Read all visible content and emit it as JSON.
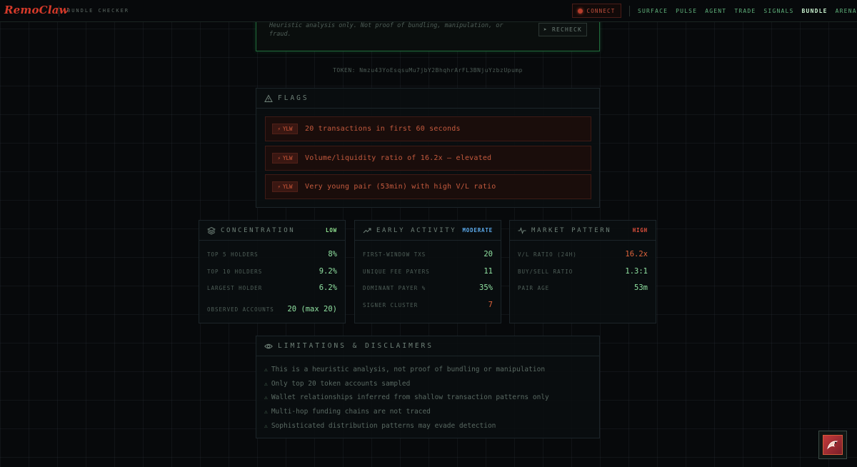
{
  "header": {
    "logo": "RemoClaw",
    "subtitle": "BUNDLE CHECKER",
    "connect_label": "CONNECT",
    "nav": [
      "SURFACE",
      "PULSE",
      "AGENT",
      "TRADE",
      "SIGNALS",
      "BUNDLE",
      "ARENA"
    ],
    "active_nav": "BUNDLE"
  },
  "summary": {
    "heuristic_note": "Heuristic analysis only. Not proof of bundling, manipulation, or fraud.",
    "recheck_label": "➤ RECHECK",
    "token_label": "TOKEN: Nmzu43YoEsqsuMu7jbY2BhqhrArFL3BNjuYzbzUpump"
  },
  "flags": {
    "title": "FLAGS",
    "items": [
      {
        "badge": "YLW",
        "text": "20 transactions in first 60 seconds"
      },
      {
        "badge": "YLW",
        "text": "Volume/liquidity ratio of 16.2x — elevated"
      },
      {
        "badge": "YLW",
        "text": "Very young pair (53min) with high V/L ratio"
      }
    ]
  },
  "cards": {
    "concentration": {
      "title": "CONCENTRATION",
      "level": "LOW",
      "level_color": "#8fe08f",
      "rows": [
        {
          "k": "TOP 5 HOLDERS",
          "v": "8%"
        },
        {
          "k": "TOP 10 HOLDERS",
          "v": "9.2%"
        },
        {
          "k": "LARGEST HOLDER",
          "v": "6.2%"
        },
        {
          "k": "OBSERVED ACCOUNTS",
          "v": "20 (max 20)"
        }
      ]
    },
    "early": {
      "title": "EARLY ACTIVITY",
      "level": "MODERATE",
      "level_color": "#5aa8e8",
      "rows": [
        {
          "k": "FIRST-WINDOW TXS",
          "v": "20"
        },
        {
          "k": "UNIQUE FEE PAYERS",
          "v": "11"
        },
        {
          "k": "DOMINANT PAYER %",
          "v": "35%"
        },
        {
          "k": "SIGNER CLUSTER",
          "v": "7"
        }
      ]
    },
    "market": {
      "title": "MARKET PATTERN",
      "level": "HIGH",
      "level_color": "#e0503c",
      "rows": [
        {
          "k": "V/L RATIO (24H)",
          "v": "16.2x"
        },
        {
          "k": "BUY/SELL RATIO",
          "v": "1.3:1"
        },
        {
          "k": "PAIR AGE",
          "v": "53m"
        }
      ]
    }
  },
  "limitations": {
    "title": "LIMITATIONS & DISCLAIMERS",
    "items": [
      "This is a heuristic analysis, not proof of bundling or manipulation",
      "Only top 20 token accounts sampled",
      "Wallet relationships inferred from shallow transaction patterns only",
      "Multi-hop funding chains are not traced",
      "Sophisticated distribution patterns may evade detection"
    ]
  },
  "colors": {
    "accent_green": "#5fb07a",
    "warn_red": "#c45a3e",
    "value_green": "#8fe0a0",
    "value_red": "#e0643c"
  }
}
